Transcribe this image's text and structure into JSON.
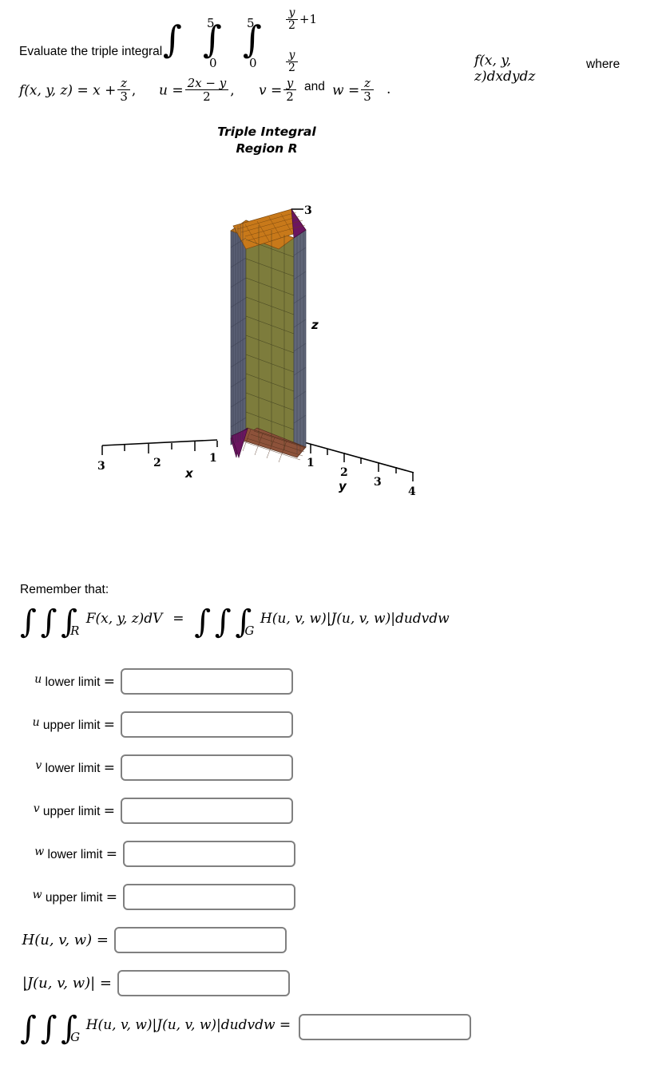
{
  "problem": {
    "lead_text": "Evaluate the triple integral",
    "integral": {
      "outer_upper": "5",
      "outer_lower": "0",
      "middle_upper": "5",
      "middle_lower": "0",
      "inner_upper_num": "y",
      "inner_upper_den": "2",
      "inner_upper_plus": "+1",
      "inner_lower_num": "y",
      "inner_lower_den": "2",
      "integrand": "f(x, y, z)dxdydz"
    },
    "where_text": "where",
    "definitions": {
      "f_label": "f(x, y, z) = x +",
      "f_frac_num": "z",
      "f_frac_den": "3",
      "u_label": "u =",
      "u_frac_num": "2x − y",
      "u_frac_den": "2",
      "v_label": "v =",
      "v_frac_num": "y",
      "v_frac_den": "2",
      "and_text": "and",
      "w_label": "w =",
      "w_frac_num": "z",
      "w_frac_den": "3",
      "period": "."
    }
  },
  "plot": {
    "title_line1": "Triple Integral",
    "title_line2": "Region R",
    "axis_labels": {
      "x": "x",
      "y": "y",
      "z": "z"
    },
    "x_ticks": [
      "3",
      "2",
      "1"
    ],
    "y_ticks": [
      "1",
      "2",
      "3",
      "4"
    ],
    "z_ticks": [
      "3"
    ],
    "colors": {
      "top_face": "#c8791a",
      "front_face": "#7d7c3c",
      "left_face": "#5a5f74",
      "right_face": "#606678",
      "bottom_face": "#8d523a",
      "corner_wedge": "#6b1560",
      "axis": "#000000"
    }
  },
  "remember": {
    "label": "Remember that:",
    "lhs_integrand": "F(x, y, z)dV",
    "lhs_sub": "R",
    "equals": "=",
    "rhs_integrand": "H(u, v, w)|J(u, v, w)|dudvdw",
    "rhs_sub": "G"
  },
  "answers": {
    "rows": [
      {
        "var": "u",
        "text": " lower limit ",
        "eq": "=",
        "value": "",
        "placeholder": ""
      },
      {
        "var": "u",
        "text": " upper limit ",
        "eq": "=",
        "value": "",
        "placeholder": ""
      },
      {
        "var": "v",
        "text": " lower limit ",
        "eq": "=",
        "value": "",
        "placeholder": ""
      },
      {
        "var": "v",
        "text": " upper limit ",
        "eq": "=",
        "value": "",
        "placeholder": ""
      },
      {
        "var": "w",
        "text": " lower limit ",
        "eq": "=",
        "value": "",
        "placeholder": ""
      },
      {
        "var": "w",
        "text": " upper limit ",
        "eq": "=",
        "value": "",
        "placeholder": ""
      }
    ],
    "h_label": "H(u, v, w) =",
    "h_value": "",
    "j_label": "|J(u, v, w)| =",
    "j_value": "",
    "final_expr": "H(u, v, w)|J(u, v, w)|dudvdw =",
    "final_sub": "G",
    "final_value": ""
  }
}
